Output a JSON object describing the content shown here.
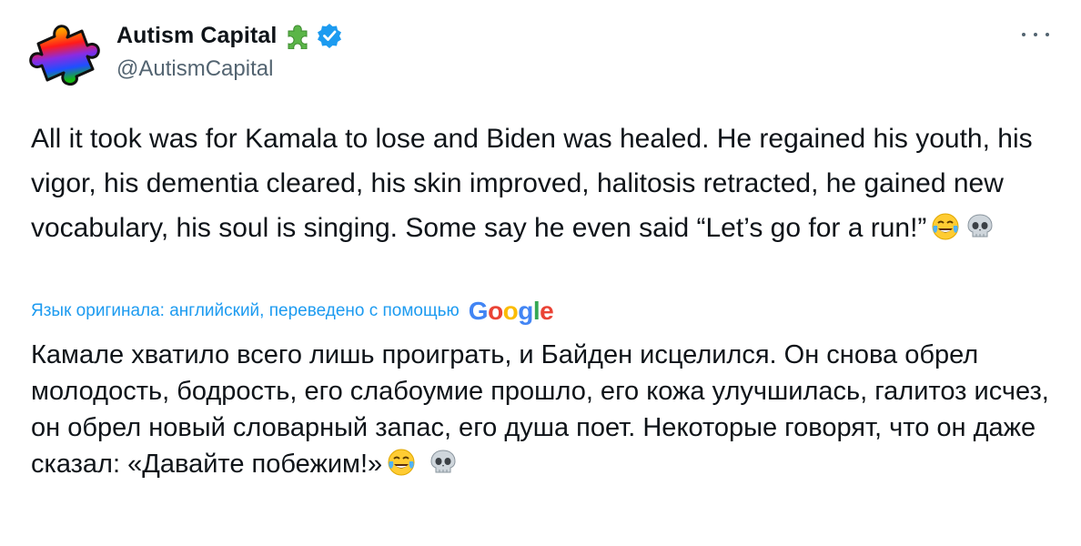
{
  "author": {
    "display_name": "Autism Capital",
    "handle": "@AutismCapital",
    "verified": true,
    "name_emoji": "puzzle-piece-icon"
  },
  "tweet": {
    "text": "All it took was for Kamala to lose and Biden was healed. He regained his youth, his vigor, his dementia cleared, his skin improved, halitosis retracted, he gained new vocabulary, his soul is singing. Some say he even said “Let’s go for a run!”",
    "emojis": [
      "face-with-tears-of-joy-icon",
      "skull-icon"
    ]
  },
  "translation": {
    "label": "Язык оригинала: английский, переведено с помощью",
    "provider": "Google",
    "text": "Камале хватило всего лишь проиграть, и Байден исцелился. Он снова обрел молодость, бодрость, его слабоумие прошло, его кожа улучшилась, галитоз исчез, он обрел новый словарный запас, его душа поет. Некоторые говорят, что он даже сказал: «Давайте побежим!»"
  },
  "colors": {
    "text": "#0f1419",
    "secondary": "#536471",
    "link": "#1d9bf0",
    "verified": "#1d9bf0",
    "puzzle": "#5bb548"
  }
}
